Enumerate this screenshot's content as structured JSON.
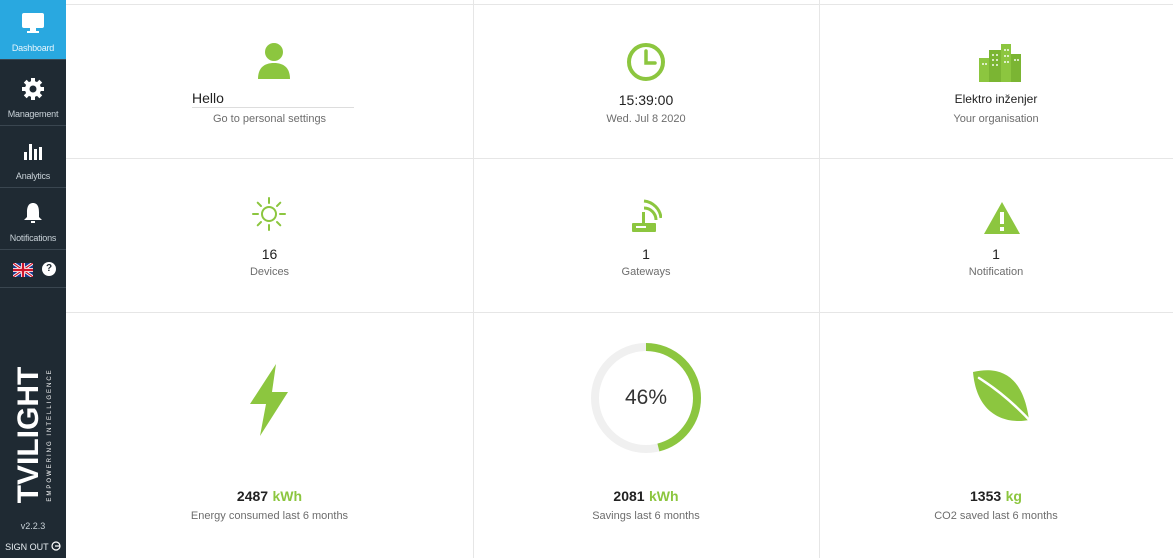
{
  "sidebar": {
    "items": [
      {
        "label": "Dashboard",
        "icon": "monitor-icon",
        "active": true
      },
      {
        "label": "Management",
        "icon": "gear-icon"
      },
      {
        "label": "Analytics",
        "icon": "bar-chart-icon"
      },
      {
        "label": "Notifications",
        "icon": "bell-icon"
      }
    ],
    "help_label": "?",
    "brand": "TVILIGHT",
    "brand_tagline": "EMPOWERING INTELLIGENCE",
    "version": "v2.2.3",
    "sign_out": "SIGN OUT"
  },
  "dashboard": {
    "user": {
      "greeting": "Hello",
      "link": "Go to personal settings",
      "icon": "user-icon"
    },
    "clock": {
      "time": "15:39:00",
      "date": "Wed. Jul 8 2020",
      "icon": "clock-icon"
    },
    "organisation": {
      "name": "Elektro inženjer",
      "label": "Your organisation",
      "icon": "buildings-icon"
    },
    "devices": {
      "count": "16",
      "label": "Devices",
      "icon": "sun-icon"
    },
    "gateways": {
      "count": "1",
      "label": "Gateways",
      "icon": "gateway-icon"
    },
    "notifications": {
      "count": "1",
      "label": "Notification",
      "icon": "warning-icon"
    },
    "energy": {
      "value": "2487",
      "unit": "kWh",
      "label": "Energy consumed last 6 months",
      "icon": "lightning-icon"
    },
    "savings": {
      "percent_text": "46%",
      "percent": 46,
      "value": "2081",
      "unit": "kWh",
      "label": "Savings last 6 months"
    },
    "co2": {
      "value": "1353",
      "unit": "kg",
      "label": "CO2 saved last 6 months",
      "icon": "leaf-icon"
    }
  },
  "colors": {
    "accent": "#8cc63f",
    "sidebar": "#1f2a33",
    "active": "#29a8e0"
  }
}
